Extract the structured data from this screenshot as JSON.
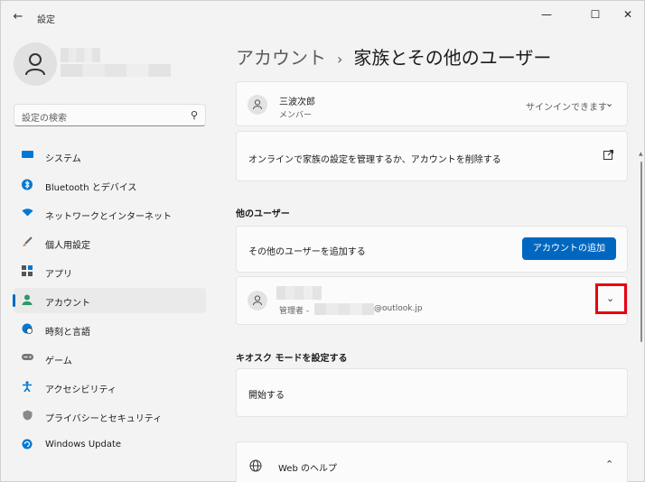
{
  "window": {
    "title": "設定",
    "controls": {
      "minimize": "—",
      "maximize": "☐",
      "close": "✕"
    }
  },
  "sidebar": {
    "search_placeholder": "設定の検索",
    "items": [
      {
        "label": "システム",
        "icon": "monitor-icon",
        "color": "#0078d4"
      },
      {
        "label": "Bluetooth とデバイス",
        "icon": "bluetooth-icon",
        "color": "#0078d4"
      },
      {
        "label": "ネットワークとインターネット",
        "icon": "wifi-icon",
        "color": "#0078d4"
      },
      {
        "label": "個人用設定",
        "icon": "brush-icon",
        "color": "#c47a2c"
      },
      {
        "label": "アプリ",
        "icon": "apps-icon",
        "color": "#555555"
      },
      {
        "label": "アカウント",
        "icon": "person-icon",
        "color": "#2b9a66",
        "active": true
      },
      {
        "label": "時刻と言語",
        "icon": "globe-clock-icon",
        "color": "#0078d4"
      },
      {
        "label": "ゲーム",
        "icon": "controller-icon",
        "color": "#666666"
      },
      {
        "label": "アクセシビリティ",
        "icon": "accessibility-icon",
        "color": "#0078d4"
      },
      {
        "label": "プライバシーとセキュリティ",
        "icon": "shield-icon",
        "color": "#777777"
      },
      {
        "label": "Windows Update",
        "icon": "update-icon",
        "color": "#0078d4"
      }
    ]
  },
  "main": {
    "breadcrumb": {
      "parent": "アカウント",
      "separator": "›",
      "current": "家族とその他のユーザー"
    },
    "family_member": {
      "name": "三波次郎",
      "role": "メンバー",
      "status": "サインインできます"
    },
    "manage_online": {
      "label": "オンラインで家族の設定を管理するか、アカウントを削除する"
    },
    "other_users": {
      "section_title": "他のユーザー",
      "add_label": "その他のユーザーを追加する",
      "add_button": "アカウントの追加",
      "user_role_prefix": "管理者 -",
      "user_email_domain": "@outlook.jp"
    },
    "kiosk": {
      "section_title": "キオスク モードを設定する",
      "start_label": "開始する"
    },
    "help": {
      "label": "Web のヘルプ"
    }
  },
  "colors": {
    "accent": "#0067c0",
    "highlight_box": "#e60012"
  }
}
